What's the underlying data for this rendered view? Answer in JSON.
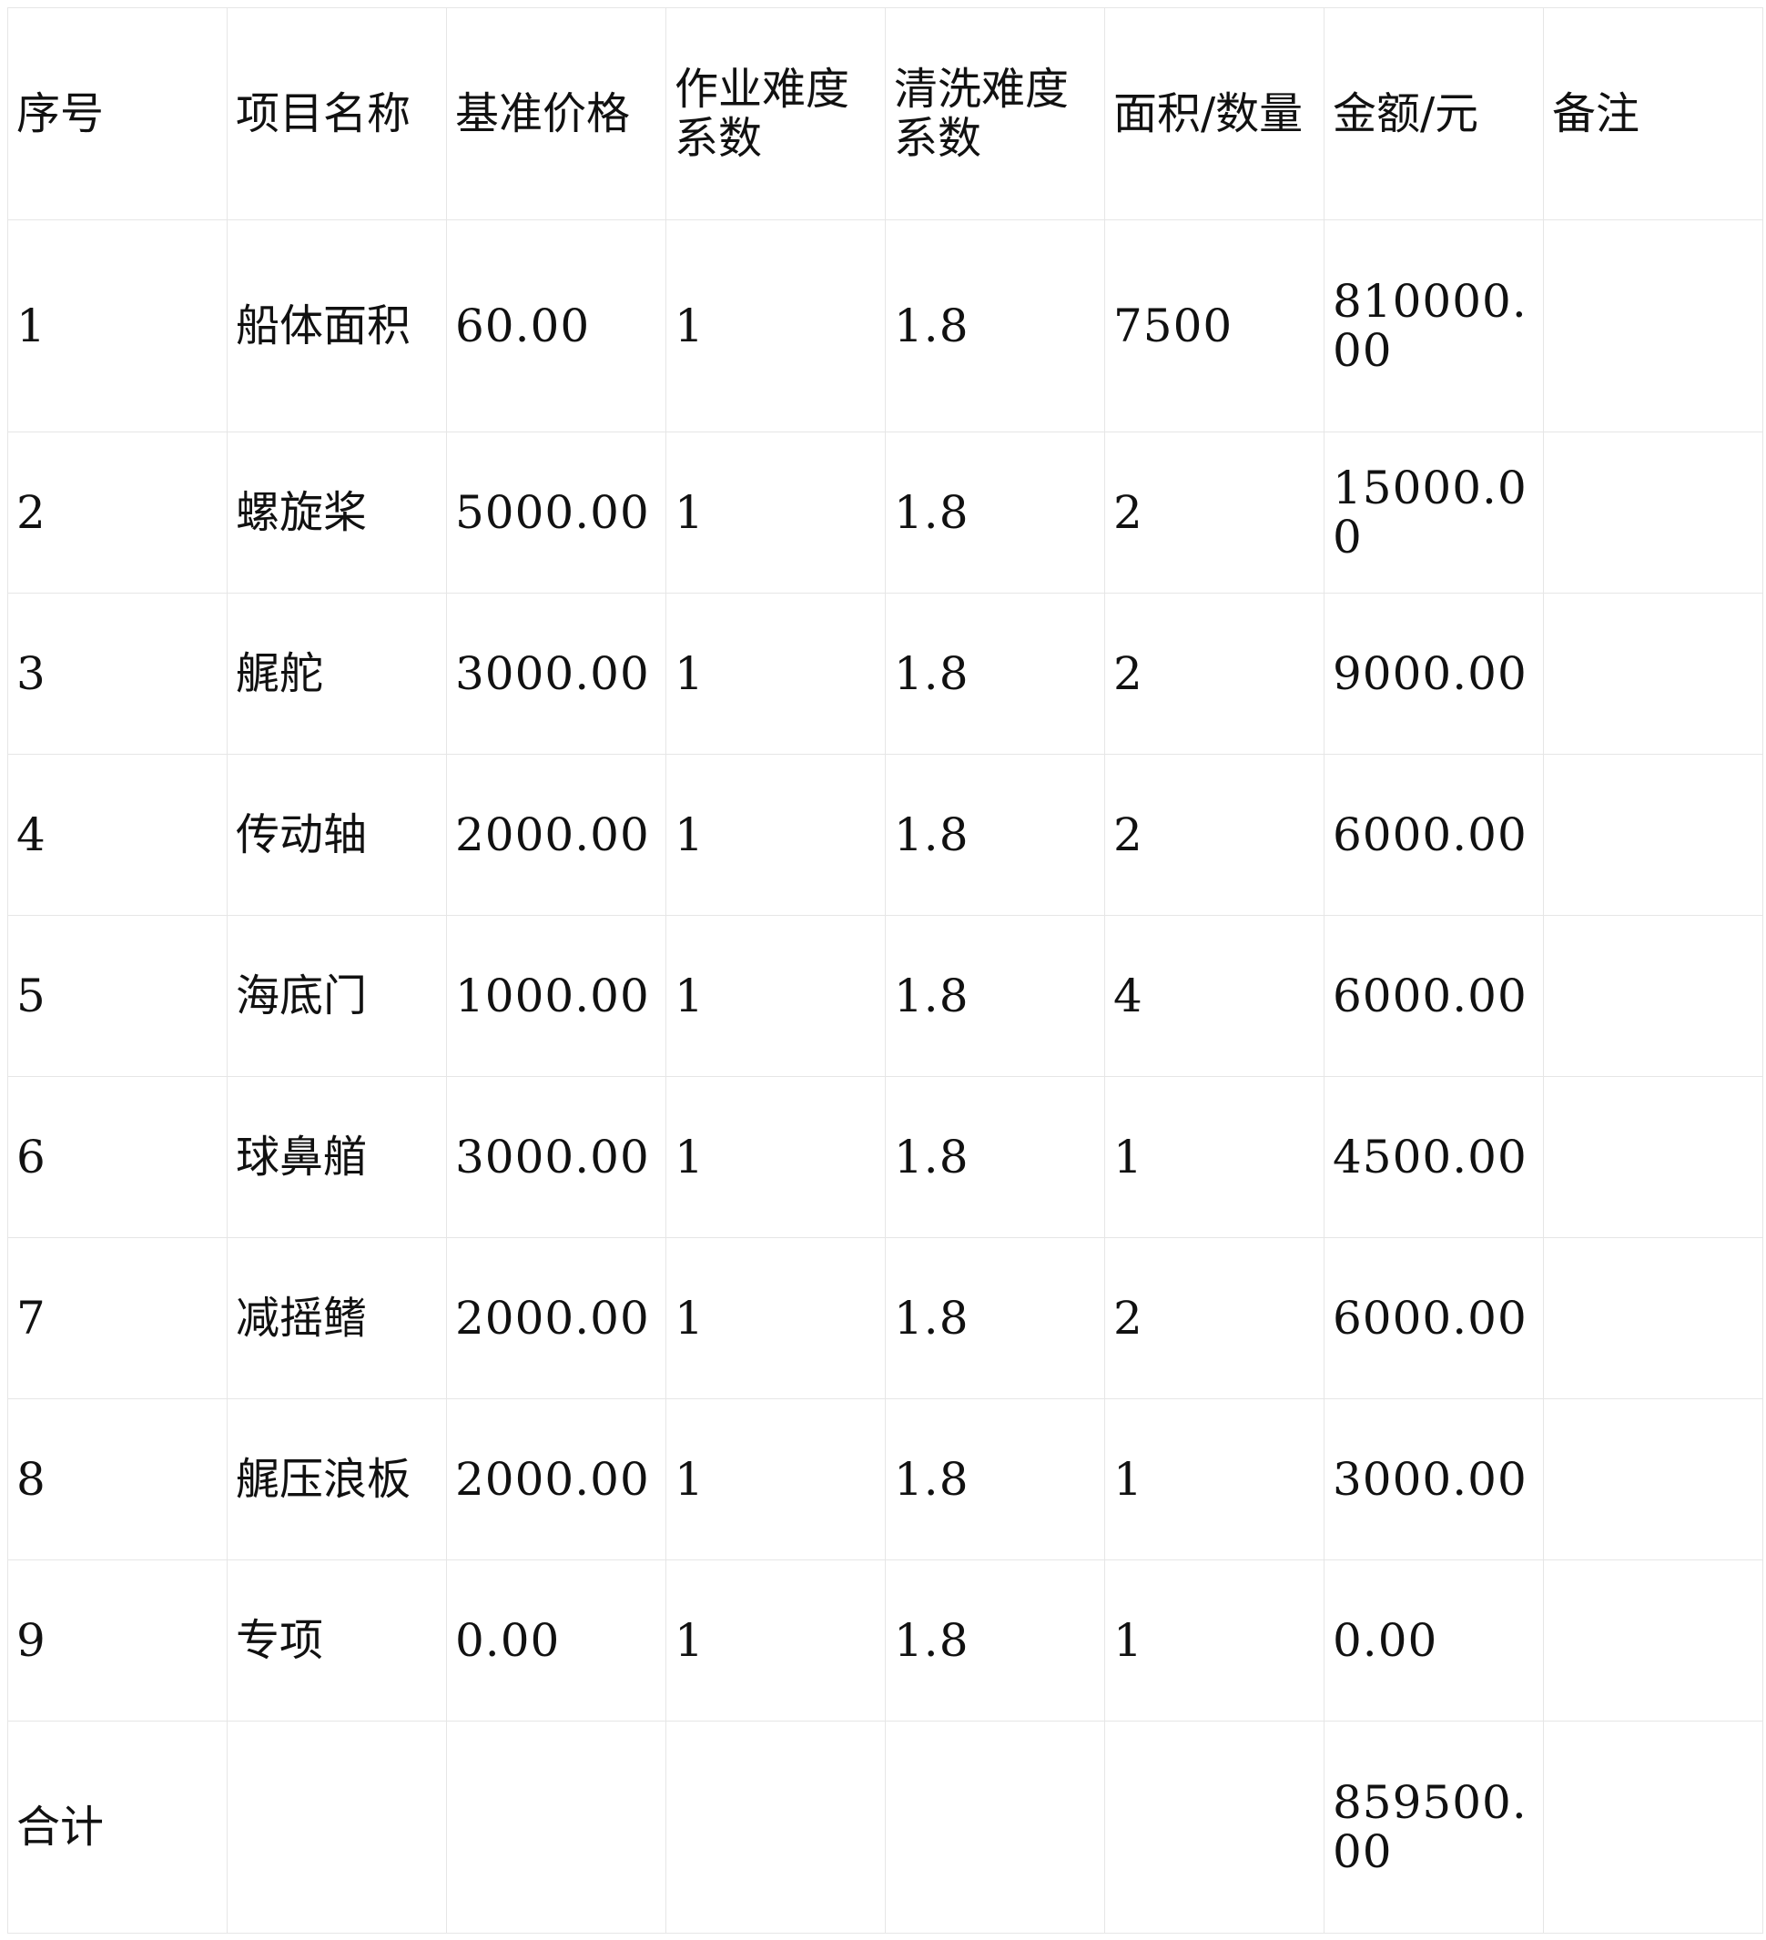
{
  "table": {
    "headers": [
      "序号",
      "项目名称",
      "基准价格",
      "作业难度系数",
      "清洗难度系数",
      "面积/数量",
      "金额/元",
      "备注"
    ],
    "rows": [
      [
        "1",
        "船体面积",
        "60.00",
        "1",
        "1.8",
        "7500",
        "810000.00",
        ""
      ],
      [
        "2",
        "螺旋桨",
        "5000.00",
        "1",
        "1.8",
        "2",
        "15000.00",
        ""
      ],
      [
        "3",
        "艉舵",
        "3000.00",
        "1",
        "1.8",
        "2",
        "9000.00",
        ""
      ],
      [
        "4",
        "传动轴",
        "2000.00",
        "1",
        "1.8",
        "2",
        "6000.00",
        ""
      ],
      [
        "5",
        "海底门",
        "1000.00",
        "1",
        "1.8",
        "4",
        "6000.00",
        ""
      ],
      [
        "6",
        "球鼻艏",
        "3000.00",
        "1",
        "1.8",
        "1",
        "4500.00",
        ""
      ],
      [
        "7",
        "减摇鳍",
        "2000.00",
        "1",
        "1.8",
        "2",
        "6000.00",
        ""
      ],
      [
        "8",
        "艉压浪板",
        "2000.00",
        "1",
        "1.8",
        "1",
        "3000.00",
        ""
      ],
      [
        "9",
        "专项",
        "0.00",
        "1",
        "1.8",
        "1",
        "0.00",
        ""
      ]
    ],
    "total": [
      "合计",
      "",
      "",
      "",
      "",
      "",
      "859500.00",
      ""
    ]
  }
}
